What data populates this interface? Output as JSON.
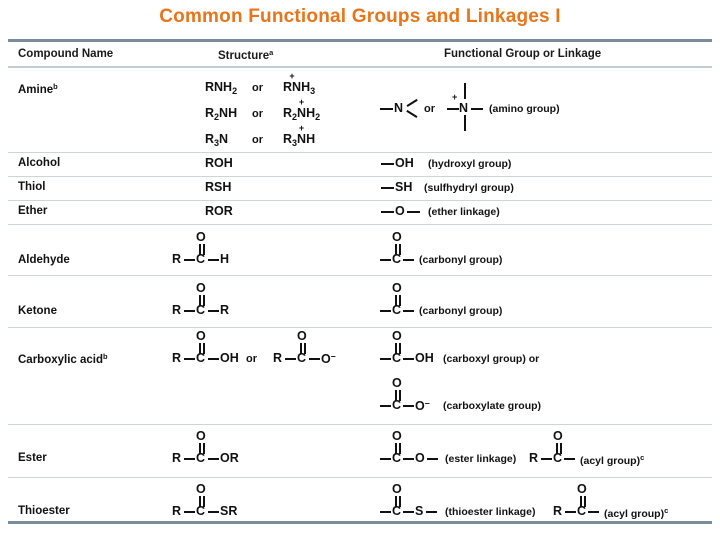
{
  "title": "Common Functional Groups and Linkages I",
  "accent_color": "#E8751A",
  "rule_color": "#7b8d9c",
  "table": {
    "headers": {
      "compound": "Compound Name",
      "structure": "Structure",
      "structure_footnote": "a",
      "functional": "Functional Group or Linkage"
    },
    "rows": [
      {
        "name": "Amine",
        "name_footnote": "b",
        "structures": [
          {
            "left": "RNH",
            "left_sub": "2",
            "conj": "or",
            "right_pre": "RN",
            "right_post": "H",
            "right_sub": "3"
          },
          {
            "left": "R",
            "left_sub1": "2",
            "left_rest": "NH",
            "conj": "or",
            "right_pre": "R",
            "right_sub_pre": "2",
            "right_mid": "N",
            "right_post": "H",
            "right_sub": "2"
          },
          {
            "left": "R",
            "left_sub1": "3",
            "left_rest": "N",
            "conj": "or",
            "right_pre": "R",
            "right_sub_pre": "3",
            "right_mid": "N",
            "right_post": "H"
          }
        ],
        "group_atom": "N",
        "group_atom_charged": "N",
        "group_charge": "+",
        "group_conj": "or",
        "group_label": "(amino group)"
      },
      {
        "name": "Alcohol",
        "structure": "ROH",
        "group_formula": "OH",
        "group_label": "(hydroxyl group)"
      },
      {
        "name": "Thiol",
        "structure": "RSH",
        "group_formula": "SH",
        "group_label": "(sulfhydryl group)"
      },
      {
        "name": "Ether",
        "structure": "ROR",
        "group_formula": "O",
        "group_label": "(ether linkage)"
      },
      {
        "name": "Aldehyde",
        "struct_left": "R",
        "struct_center": "C",
        "struct_right": "H",
        "struct_top": "O",
        "group_center": "C",
        "group_top": "O",
        "group_label": "(carbonyl group)"
      },
      {
        "name": "Ketone",
        "struct_left": "R",
        "struct_center": "C",
        "struct_right": "R",
        "struct_top": "O",
        "group_center": "C",
        "group_top": "O",
        "group_label": "(carbonyl group)"
      },
      {
        "name": "Carboxylic acid",
        "name_footnote": "b",
        "struct_left": "R",
        "struct_center": "C",
        "struct_right": "OH",
        "struct_top": "O",
        "struct_conj": "or",
        "struct2_left": "R",
        "struct2_center": "C",
        "struct2_right": "O",
        "struct2_charge": "–",
        "struct2_top": "O",
        "group_center": "C",
        "group_top": "O",
        "group_right": "OH",
        "group_label": "(carboxyl group) or",
        "group2_center": "C",
        "group2_top": "O",
        "group2_right": "O",
        "group2_charge": "–",
        "group2_label": "(carboxylate group)"
      },
      {
        "name": "Ester",
        "struct_left": "R",
        "struct_center": "C",
        "struct_right": "OR",
        "struct_top": "O",
        "group_center": "C",
        "group_right": "O",
        "group_top": "O",
        "group_label": "(ester linkage)",
        "acyl_left": "R",
        "acyl_center": "C",
        "acyl_top": "O",
        "acyl_label": "(acyl group)",
        "acyl_footnote": "c"
      },
      {
        "name": "Thioester",
        "struct_left": "R",
        "struct_center": "C",
        "struct_right": "SR",
        "struct_top": "O",
        "group_center": "C",
        "group_right": "S",
        "group_top": "O",
        "group_label": "(thioester linkage)",
        "acyl_left": "R",
        "acyl_center": "C",
        "acyl_top": "O",
        "acyl_label": "(acyl group)",
        "acyl_footnote": "c"
      }
    ]
  }
}
